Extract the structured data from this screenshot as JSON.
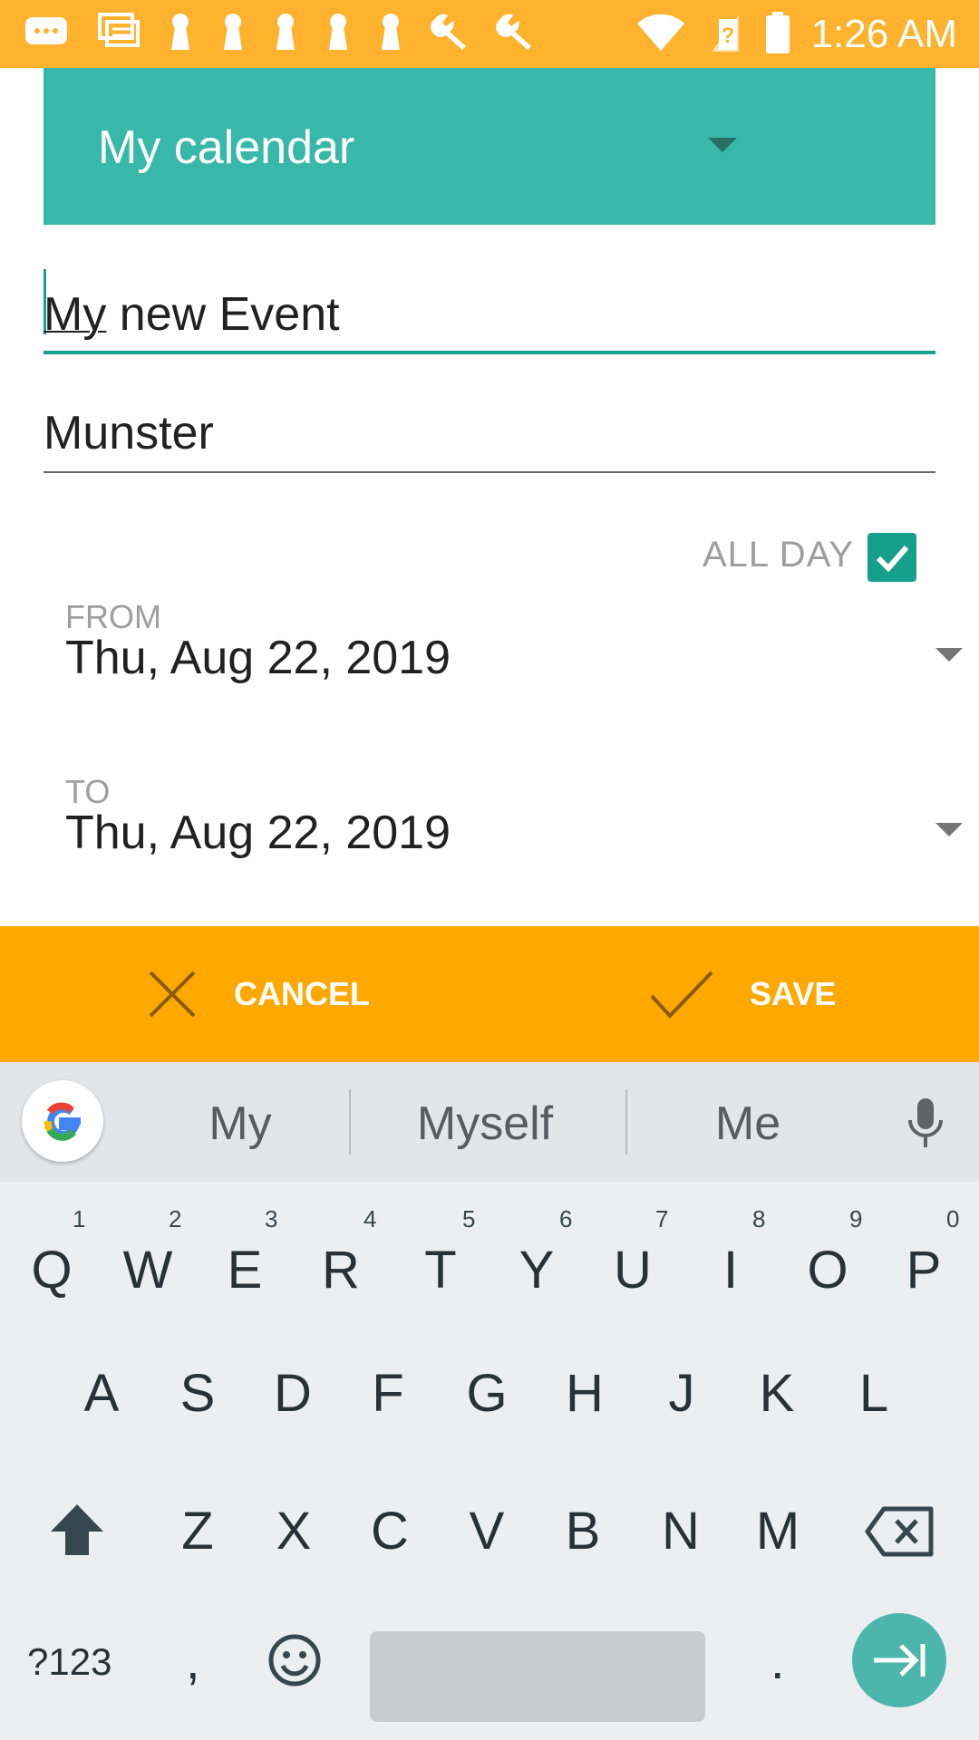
{
  "status_bar": {
    "time": "1:26 AM",
    "icons": [
      "chat-bubble-icon",
      "messages-icon",
      "keyhole-icon",
      "keyhole-icon",
      "keyhole-icon",
      "keyhole-icon",
      "keyhole-icon",
      "wrench-icon",
      "wrench-icon",
      "wifi-icon",
      "no-sim-icon",
      "battery-icon"
    ]
  },
  "form": {
    "calendar_name": "My calendar",
    "title_value": "My new Event",
    "title_underlined_word": "My",
    "title_rest": " new Event",
    "location_value": "Munster",
    "all_day_label": "ALL DAY",
    "all_day_checked": true,
    "from_label": "FROM",
    "from_value": "Thu, Aug 22, 2019",
    "to_label": "TO",
    "to_value": "Thu, Aug 22, 2019"
  },
  "actions": {
    "cancel_label": "CANCEL",
    "save_label": "SAVE"
  },
  "keyboard": {
    "suggestions": [
      "My",
      "Myself",
      "Me"
    ],
    "row1": [
      "Q",
      "W",
      "E",
      "R",
      "T",
      "Y",
      "U",
      "I",
      "O",
      "P"
    ],
    "row1_hints": [
      "1",
      "2",
      "3",
      "4",
      "5",
      "6",
      "7",
      "8",
      "9",
      "0"
    ],
    "row2": [
      "A",
      "S",
      "D",
      "F",
      "G",
      "H",
      "J",
      "K",
      "L"
    ],
    "row3": [
      "Z",
      "X",
      "C",
      "V",
      "B",
      "N",
      "M"
    ],
    "symbols_label": "?123",
    "comma_label": ",",
    "period_label": "."
  },
  "colors": {
    "status_bar": "#FFB22E",
    "calendar_header": "#37B8A8",
    "accent": "#16A08C",
    "action_bar": "#FFA800",
    "keyboard_bg": "#ECEFF1"
  }
}
